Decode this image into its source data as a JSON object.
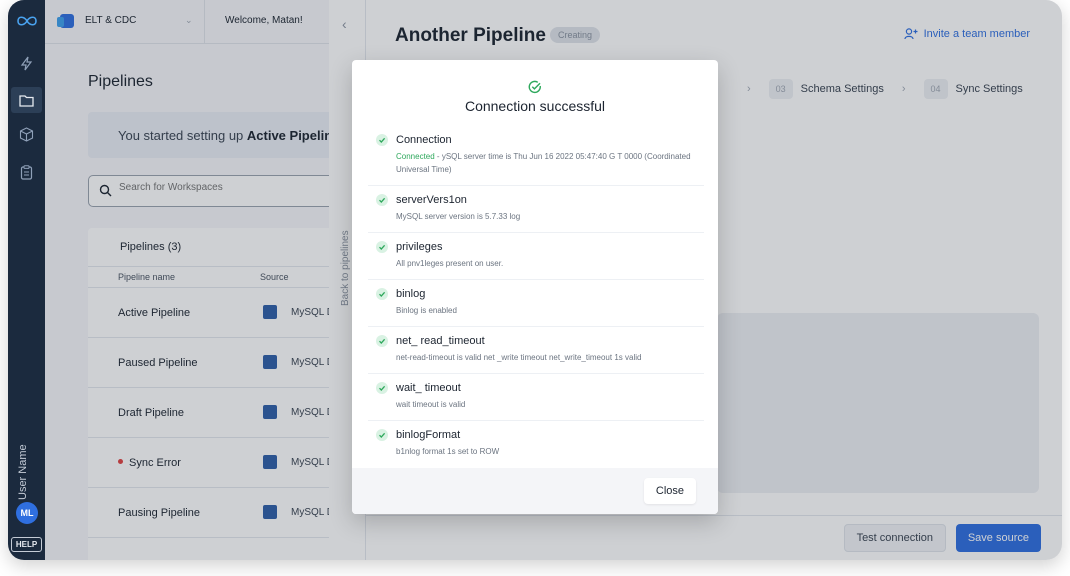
{
  "rail": {
    "items": [
      "infinity-logo-icon",
      "bolt-icon",
      "folder-icon",
      "cube-icon",
      "clipboard-icon"
    ],
    "user_name": "User Name",
    "avatar_initials": "ML",
    "help_label": "HELP"
  },
  "topbar": {
    "workspace": "ELT & CDC",
    "welcome": "Welcome, Matan!"
  },
  "pipelines_page": {
    "title": "Pipelines",
    "banner_prefix": "You started setting up ",
    "banner_bold": "Active Pipeline",
    "search_placeholder": "Search for Workspaces",
    "table_title": "Pipelines (3)",
    "columns": [
      "Pipeline name",
      "Source"
    ],
    "rows": [
      {
        "name": "Active Pipeline",
        "source": "MySQL D"
      },
      {
        "name": "Paused Pipeline",
        "source": "MySQL D"
      },
      {
        "name": "Draft Pipeline",
        "source": "MySQL D"
      },
      {
        "name": "Sync Error",
        "source": "MySQL D",
        "status": "error"
      },
      {
        "name": "Pausing Pipeline",
        "source": "MySQL D"
      }
    ]
  },
  "panel": {
    "back_label": "Back to pipelines",
    "title": "Another Pipeline",
    "badge": "Creating",
    "invite_label": "Invite a team member",
    "steps": [
      {
        "num": "03",
        "label": "Schema Settings"
      },
      {
        "num": "04",
        "label": "Sync Settings"
      }
    ],
    "test_label": "Test connection",
    "save_label": "Save source"
  },
  "modal": {
    "title": "Connection successful",
    "checks": [
      {
        "name": "Connection",
        "status": "Connected",
        "desc": " - ySQL server time is Thu Jun 16 2022 05:47:40 G  T  0000 (Coordinated Universal Time)"
      },
      {
        "name": "serverVers1on",
        "desc": "MySQL server version is 5.7.33 log"
      },
      {
        "name": "privileges",
        "desc": "All pnv1leges present on user."
      },
      {
        "name": "binlog",
        "desc": "Binlog is enabled"
      },
      {
        "name": "net_ read_timeout",
        "desc": "net-read-timeout is valid net _write   timeout net_write_timeout 1s valid"
      },
      {
        "name": "wait_ timeout",
        "desc": "wait timeout is valid"
      },
      {
        "name": "binlogFormat",
        "desc": "b1nlog format 1s set to ROW"
      }
    ],
    "close_label": "Close"
  },
  "colors": {
    "rail_bg": "#1b2a3e",
    "accent": "#2f6fe0",
    "success": "#2ea85c",
    "error": "#e04242"
  }
}
